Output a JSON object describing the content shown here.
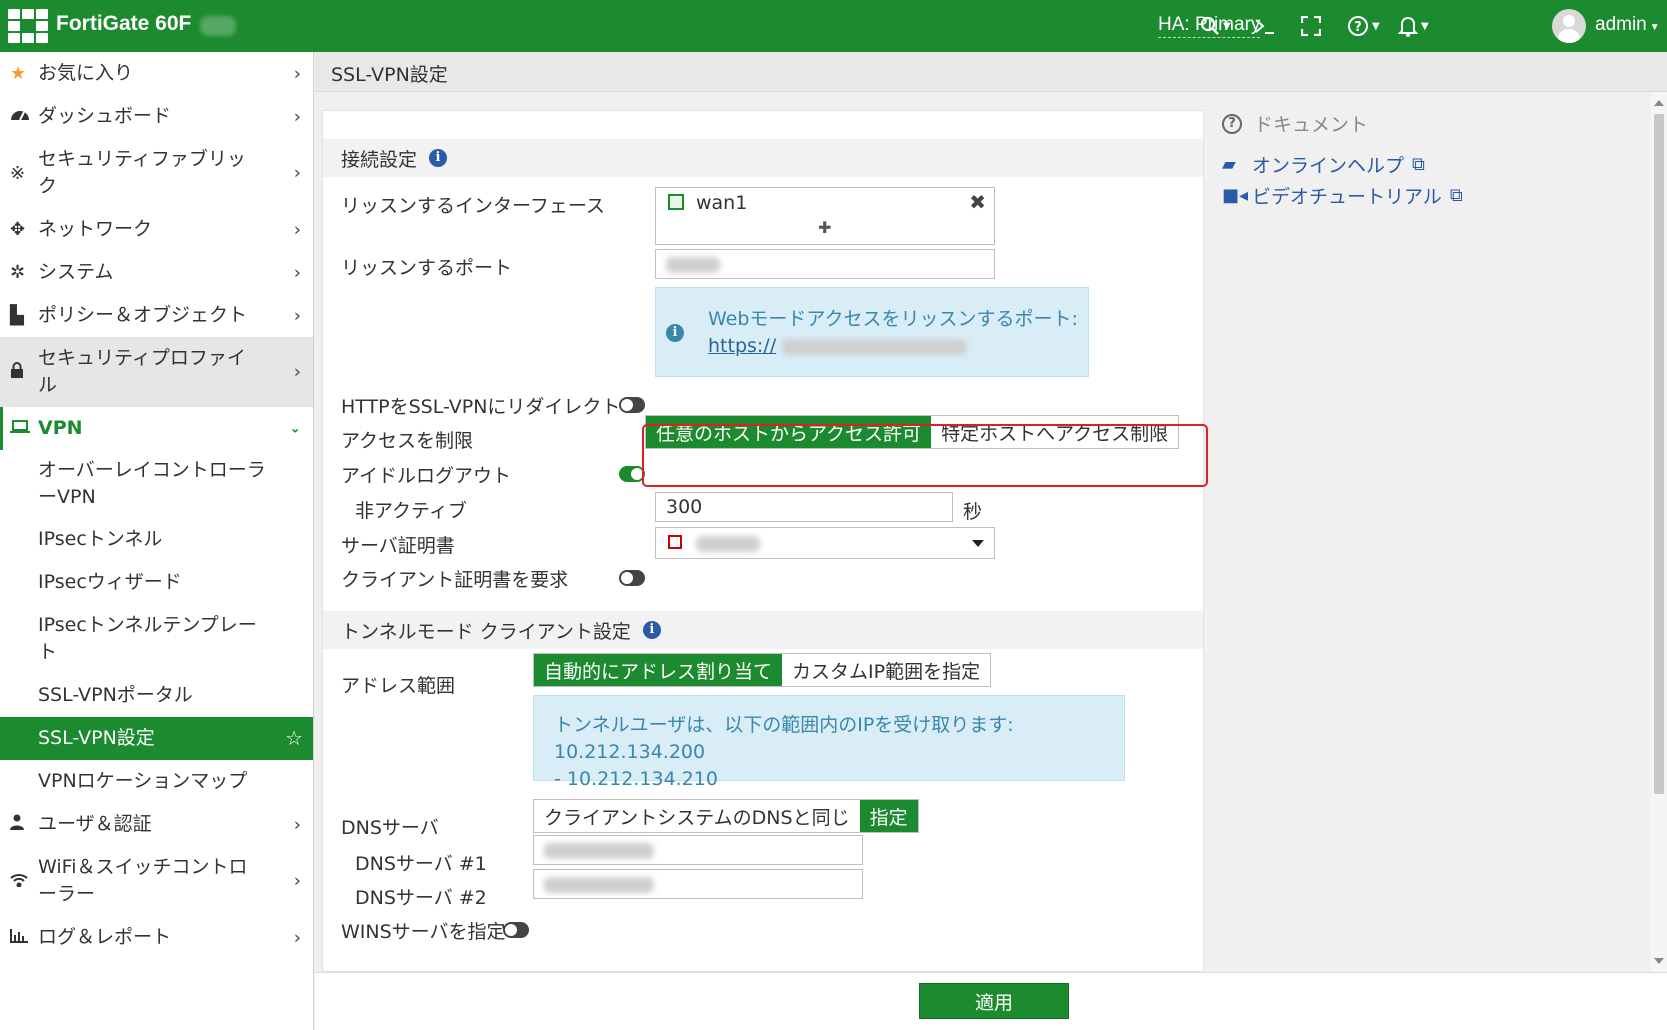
{
  "header": {
    "device": "FortiGate 60F",
    "ha": "HA: Primary",
    "username": "admin",
    "search_icon": "search-icon",
    "cli_icon": "terminal-icon"
  },
  "sidebar": {
    "items": [
      {
        "label": "お気に入り",
        "icon": "star-icon"
      },
      {
        "label": "ダッシュボード",
        "icon": "dashboard-icon"
      },
      {
        "label": "セキュリティファブリック",
        "icon": "fabric-icon"
      },
      {
        "label": "ネットワーク",
        "icon": "network-icon"
      },
      {
        "label": "システム",
        "icon": "gear-icon"
      },
      {
        "label": "ポリシー＆オブジェクト",
        "icon": "policy-icon"
      },
      {
        "label": "セキュリティプロファイル",
        "icon": "lock-icon"
      },
      {
        "label": "VPN",
        "icon": "laptop-icon"
      },
      {
        "label": "ユーザ＆認証",
        "icon": "user-icon"
      },
      {
        "label": "WiFi＆スイッチコントローラー",
        "icon": "wifi-icon"
      },
      {
        "label": "ログ＆レポート",
        "icon": "chart-icon"
      }
    ],
    "vpn_sub": [
      "オーバーレイコントローラーVPN",
      "IPsecトンネル",
      "IPsecウィザード",
      "IPsecトンネルテンプレート",
      "SSL-VPNポータル",
      "SSL-VPN設定",
      "VPNロケーションマップ"
    ]
  },
  "page": {
    "breadcrumb": "SSL-VPN設定",
    "apply": "適用"
  },
  "conn": {
    "title": "接続設定",
    "listen_iface_label": "リッスンするインターフェース",
    "iface_value": "wan1",
    "listen_port_label": "リッスンするポート",
    "web_info": "Webモードアクセスをリッスンするポート:",
    "web_link": "https://",
    "redirect_label": "HTTPをSSL-VPNにリダイレクト",
    "restrict_label": "アクセスを制限",
    "restrict_opt1": "任意のホストからアクセス許可",
    "restrict_opt2": "特定ホストへアクセス制限",
    "idle_label": "アイドルログアウト",
    "inactive_label": "非アクティブ",
    "inactive_value": "300",
    "inactive_unit": "秒",
    "cert_label": "サーバ証明書",
    "client_cert_label": "クライアント証明書を要求"
  },
  "tunnel": {
    "title": "トンネルモード クライアント設定",
    "addr_label": "アドレス範囲",
    "addr_opt1": "自動的にアドレス割り当て",
    "addr_opt2": "カスタムIP範囲を指定",
    "addr_info_1": "トンネルユーザは、以下の範囲内のIPを受け取ります: 10.212.134.200",
    "addr_info_2": "- 10.212.134.210",
    "dns_label": "DNSサーバ",
    "dns_opt1": "クライアントシステムのDNSと同じ",
    "dns_opt2": "指定",
    "dns1_label": "DNSサーバ #1",
    "dns2_label": "DNSサーバ #2",
    "wins_label": "WINSサーバを指定"
  },
  "docs": {
    "title": "ドキュメント",
    "link1": "オンラインヘルプ",
    "link2": "ビデオチュートリアル"
  }
}
